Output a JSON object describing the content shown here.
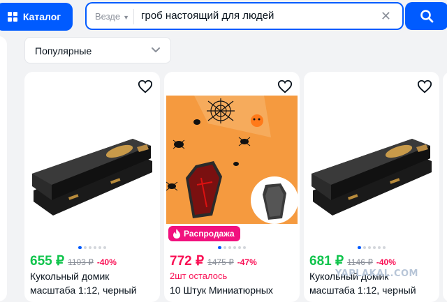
{
  "header": {
    "catalog_label": "Каталог",
    "search_scope": "Везде",
    "search_query": "гроб настоящий для людей"
  },
  "sort": {
    "selected": "Популярные"
  },
  "products": [
    {
      "price": "655 ₽",
      "old_price": "1103 ₽",
      "discount": "-40%",
      "title_line1": "Кукольный домик",
      "title_line2": "масштаба 1:12, черный",
      "price_color": "#10c44c",
      "discount_color": "#f91155"
    },
    {
      "badge": "Распродажа",
      "price": "772 ₽",
      "old_price": "1475 ₽",
      "discount": "-47%",
      "stock": "2шт осталось",
      "title_line2": "10 Штук Миниатюрных",
      "price_color": "#f91155",
      "discount_color": "#f91155"
    },
    {
      "price": "681 ₽",
      "old_price": "1146 ₽",
      "discount": "-40%",
      "title_line1": "Кукольный домик",
      "title_line2": "масштаба 1:12, черный",
      "price_color": "#10c44c",
      "discount_color": "#f91155"
    }
  ],
  "watermark": "YAPLAKAL.COM",
  "icons": {
    "catalog": "grid-icon",
    "clear": "close-icon",
    "search": "search-icon",
    "sort": "chevron-down-icon",
    "favorite": "heart-icon",
    "sale": "fire-icon"
  },
  "colors": {
    "accent": "#005bff",
    "sale_pink": "#f1117e",
    "green_price": "#10c44c",
    "red": "#f91155"
  }
}
